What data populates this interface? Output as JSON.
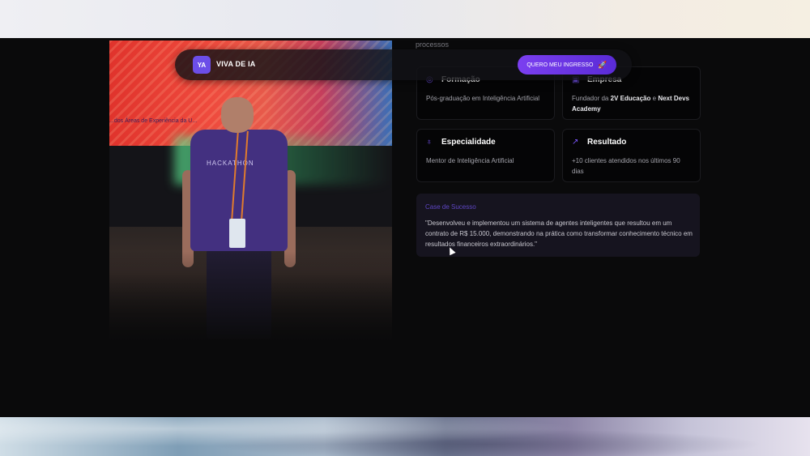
{
  "nav": {
    "logo_text": "YA",
    "brand": "VIVA DE IA",
    "cta_label": "QUERO MEU INGRESSO",
    "cta_icon": "rocket-icon"
  },
  "photo": {
    "wall_text": "...dos Áreas de Experiência da U...",
    "shirt_text": "HACKATHON"
  },
  "section_peek": "processos",
  "cards": [
    {
      "icon": "graduation-icon",
      "title": "Formação",
      "text": "Pós-graduação em Inteligência Artificial"
    },
    {
      "icon": "building-icon",
      "title": "Empresa",
      "text_prefix": "Fundador da ",
      "text_bold1": "2V Educação",
      "text_mid": " e ",
      "text_bold2": "Next Devs Academy"
    },
    {
      "icon": "award-icon",
      "title": "Especialidade",
      "text": "Mentor de Inteligência Artificial"
    },
    {
      "icon": "trend-up-icon",
      "title": "Resultado",
      "text": "+10 clientes atendidos nos últimos 90 dias"
    }
  ],
  "case": {
    "label": "Case de Sucesso",
    "quote": "\"Desenvolveu e implementou um sistema de agentes inteligentes que resultou em um contrato de R$ 15.000, demonstrando na prática como transformar conhecimento técnico em resultados financeiros extraordinários.\""
  },
  "colors": {
    "accent": "#6c4ee8",
    "background": "#0a0a0b",
    "card_bg": "#050506"
  }
}
